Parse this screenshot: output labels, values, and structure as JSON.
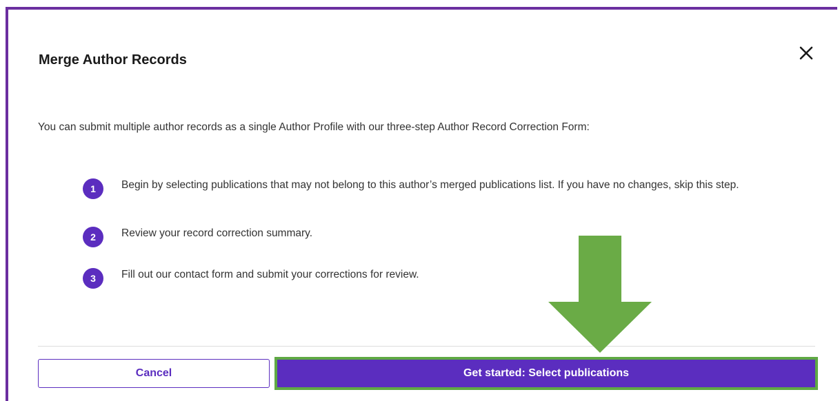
{
  "dialog": {
    "title": "Merge Author Records",
    "close_label": "close",
    "intro": "You can submit multiple author records as a single Author Profile with our three-step Author Record Correction Form:",
    "steps": [
      {
        "number": "1",
        "text": "Begin by selecting publications that may not belong to this author’s merged publications list. If you have no changes, skip this step."
      },
      {
        "number": "2",
        "text": "Review your record correction summary."
      },
      {
        "number": "3",
        "text": "Fill out our contact form and submit your corrections for review."
      }
    ],
    "cancel_label": "Cancel",
    "primary_label": "Get started: Select publications"
  },
  "colors": {
    "border": "#6b2fa0",
    "accent": "#5b2dbf",
    "highlight": "#5fa844",
    "annotation_arrow": "#6aab46"
  },
  "icons": {
    "close": "close-icon",
    "annotation": "down-arrow-icon"
  }
}
